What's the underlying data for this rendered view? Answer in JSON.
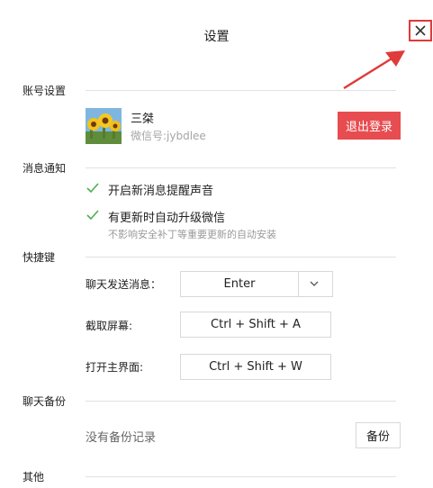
{
  "window": {
    "title": "设置"
  },
  "sections": {
    "account": "账号设置",
    "notify": "消息通知",
    "shortcut": "快捷键",
    "backup": "聊天备份",
    "other": "其他"
  },
  "account": {
    "name": "三桀",
    "wechat_id": "微信号:jybdlee",
    "logout_label": "退出登录"
  },
  "notifications": {
    "sound_label": "开启新消息提醒声音",
    "sound_checked": true,
    "auto_upgrade_label": "有更新时自动升级微信",
    "auto_upgrade_checked": true,
    "auto_upgrade_note": "不影响安全补丁等重要更新的自动安装"
  },
  "shortcuts": {
    "send_label": "聊天发送消息：",
    "send_value": "Enter",
    "screenshot_label": "截取屏幕:",
    "screenshot_value": "Ctrl + Shift + A",
    "open_main_label": "打开主界面:",
    "open_main_value": "Ctrl + Shift + W"
  },
  "backup": {
    "status": "没有备份记录",
    "button_label": "备份"
  },
  "colors": {
    "accent_red": "#e74c50",
    "check_green": "#4caf50",
    "annotation_red": "#e03a3a"
  }
}
